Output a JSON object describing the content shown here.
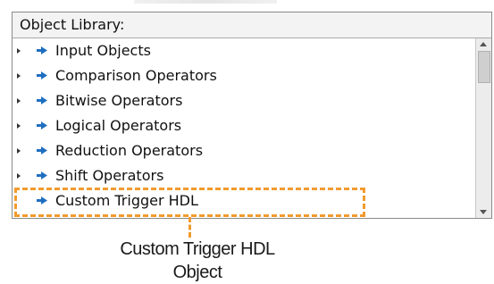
{
  "panel": {
    "header": "Object Library:",
    "items": [
      {
        "label": "Input Objects",
        "expandable": true
      },
      {
        "label": "Comparison Operators",
        "expandable": true
      },
      {
        "label": "Bitwise Operators",
        "expandable": true
      },
      {
        "label": "Logical Operators",
        "expandable": true
      },
      {
        "label": "Reduction Operators",
        "expandable": true
      },
      {
        "label": "Shift Operators",
        "expandable": true
      },
      {
        "label": "Custom Trigger HDL",
        "expandable": false
      }
    ]
  },
  "callout": {
    "label": "Custom Trigger HDL Object",
    "color": "#f29a2e"
  },
  "colors": {
    "item_icon": "#1f6fc0"
  }
}
